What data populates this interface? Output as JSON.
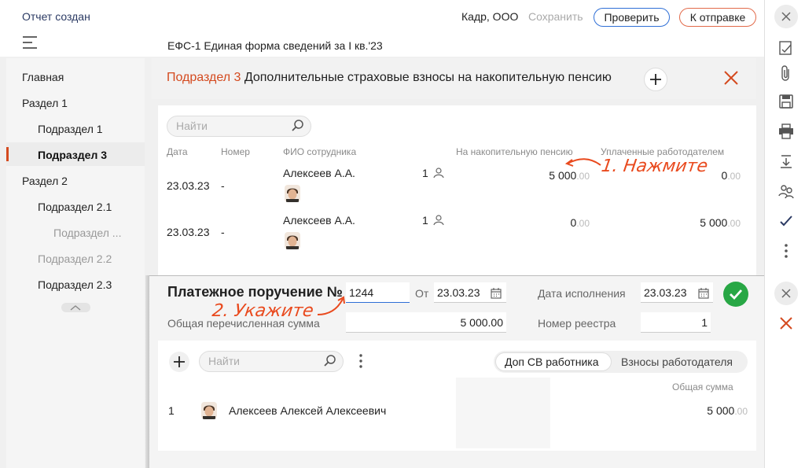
{
  "header": {
    "status": "Отчет создан",
    "doc_title": "ЕФС-1 Единая форма сведений за I кв.'23",
    "org": "Кадр, ООО",
    "save_label": "Сохранить",
    "check_label": "Проверить",
    "send_label": "К отправке"
  },
  "sidebar": {
    "items": [
      {
        "label": "Главная"
      },
      {
        "label": "Раздел 1"
      },
      {
        "label": "Подраздел 1"
      },
      {
        "label": "Подраздел 3"
      },
      {
        "label": "Раздел 2"
      },
      {
        "label": "Подраздел 2.1"
      },
      {
        "label": "Подраздел ..."
      },
      {
        "label": "Подраздел 2.2"
      },
      {
        "label": "Подраздел 2.3"
      }
    ]
  },
  "section": {
    "prefix": "Подраздел 3",
    "title": "Дополнительные страховые взносы на накопительную пенсию"
  },
  "table": {
    "search_placeholder": "Найти",
    "columns": [
      "Дата",
      "Номер",
      "ФИО сотрудника",
      "На накопительную пенсию",
      "Уплаченные работодателем"
    ],
    "rows": [
      {
        "date": "23.03.23",
        "number": "-",
        "name": "Алексеев А.А.",
        "count": "1",
        "pension_int": "5 000",
        "pension_dec": ".00",
        "employer_int": "0",
        "employer_dec": ".00"
      },
      {
        "date": "23.03.23",
        "number": "-",
        "name": "Алексеев А.А.",
        "count": "1",
        "pension_int": "0",
        "pension_dec": ".00",
        "employer_int": "5 000",
        "employer_dec": ".00"
      }
    ]
  },
  "payment": {
    "title": "Платежное поручение №",
    "number": "1244",
    "from_label": "От",
    "from_date": "23.03.23",
    "exec_label": "Дата исполнения",
    "exec_date": "23.03.23",
    "sum_label": "Общая перечисленная сумма",
    "sum_value": "5 000.00",
    "registry_label": "Номер реестра",
    "registry_value": "1"
  },
  "inner": {
    "search_placeholder": "Найти",
    "tabs": [
      "Доп СВ работника",
      "Взносы работодателя"
    ],
    "col_total": "Общая сумма",
    "rows": [
      {
        "index": "1",
        "name": "Алексеев Алексей Алексеевич",
        "total_int": "5 000",
        "total_dec": ".00"
      }
    ]
  },
  "annotations": {
    "step1": "1. Нажмите",
    "step2": "2. Укажите"
  },
  "colors": {
    "accent_red": "#d44a1f",
    "annotation": "#e94a1e",
    "primary_blue": "#2f6fd6",
    "success_green": "#28a745"
  },
  "icons": [
    "hamburger-icon",
    "close-icon",
    "checklist-icon",
    "paperclip-icon",
    "save-icon",
    "printer-icon",
    "download-icon",
    "people-icon",
    "checkmark-icon",
    "more-icon",
    "search-icon",
    "plus-icon",
    "calendar-icon",
    "person-icon"
  ]
}
